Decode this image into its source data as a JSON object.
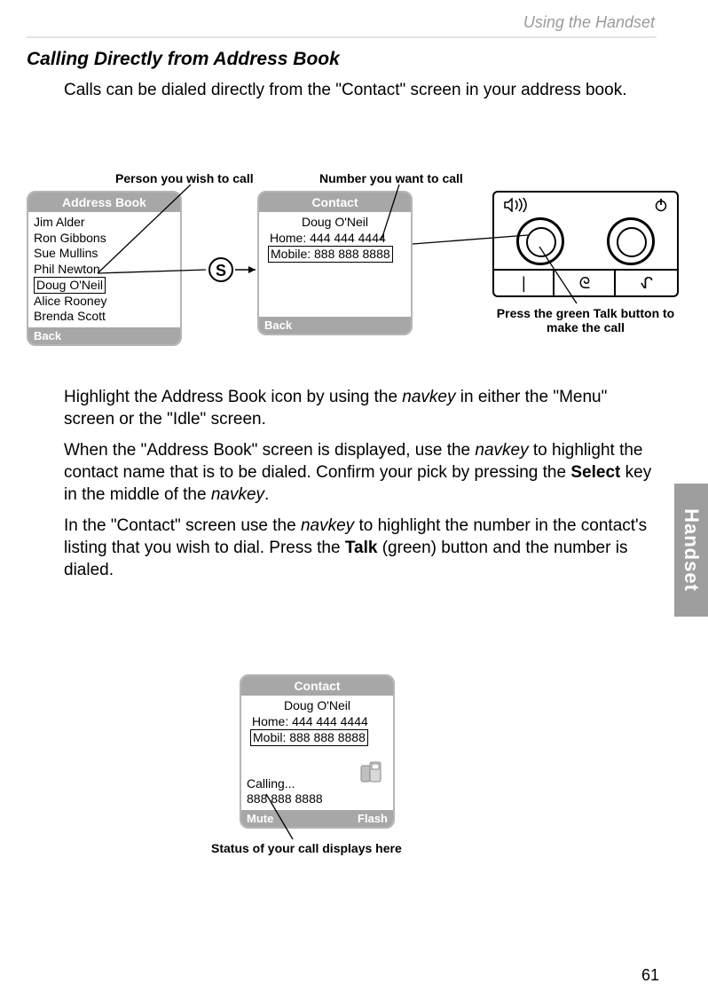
{
  "header_section": "Using the Handset",
  "section_title": "Calling Directly from Address Book",
  "intro": "Calls can be dialed directly from the \"Contact\" screen in your address book.",
  "captions": {
    "person": "Person you wish to call",
    "number": "Number you want to call",
    "press": "Press the green Talk button to make the call",
    "status": "Status of your call displays here"
  },
  "screen1": {
    "title": "Address Book",
    "items": [
      "Jim Alder",
      "Ron Gibbons",
      "Sue Mullins",
      "Phil Newton",
      "Doug O'Neil",
      "Alice Rooney",
      "Brenda Scott"
    ],
    "highlighted_index": 4,
    "back": "Back"
  },
  "screen2": {
    "title": "Contact",
    "name": "Doug O'Neil",
    "line1": "Home: 444 444 4444",
    "line2": "Mobile: 888 888 8888",
    "back": "Back"
  },
  "screen3": {
    "title": "Contact",
    "name": "Doug O'Neil",
    "line1": "Home: 444 444 4444",
    "line2": "Mobil: 888 888 8888",
    "calling": "Calling...",
    "dialed": "888 888 8888",
    "left": "Mute",
    "right": "Flash"
  },
  "s_button": "S",
  "keypad": {
    "k1": "|",
    "k2": "ᘓ",
    "k3": "ᖋ"
  },
  "paragraphs": {
    "p1_a": "Highlight the Address Book icon by using the ",
    "p1_nav": "navkey",
    "p1_b": " in either the \"Menu\" screen or the \"Idle\" screen.",
    "p2_a": "When the \"Address Book\" screen is displayed, use the ",
    "p2_nav": "navkey",
    "p2_b": " to highlight the contact name that is to be dialed. Confirm your pick by pressing the ",
    "p2_bold": "Select",
    "p2_c": " key in the middle of the ",
    "p2_nav2": "navkey",
    "p2_d": ".",
    "p3_a": "In the \"Contact\" screen use the ",
    "p3_nav": "navkey",
    "p3_b": " to highlight the number in the contact's listing that you wish to dial. Press the ",
    "p3_bold": "Talk",
    "p3_c": " (green) button and the number is dialed."
  },
  "side_tab": "Handset",
  "page_number": "61"
}
